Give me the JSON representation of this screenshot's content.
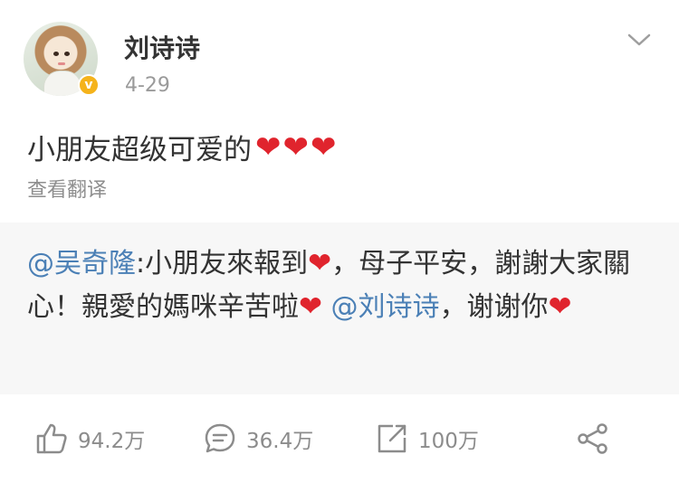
{
  "post": {
    "username": "刘诗诗",
    "date": "4-29",
    "text": "小朋友超级可爱的",
    "hearts": "❤❤❤",
    "translate_label": "查看翻译"
  },
  "repost": {
    "mention1": "@吴奇隆",
    "part1": ":小朋友來報到",
    "part2": "，母子平安，謝謝大家關心！親愛的媽咪辛苦啦",
    "mention2": "@刘诗诗",
    "part3": "，谢谢你",
    "heart": "❤"
  },
  "actions": {
    "like_count": "94.2万",
    "comment_count": "36.4万",
    "share_count": "100万"
  },
  "icons": {
    "menu": "chevron-down-icon",
    "verified": "verified-badge-icon",
    "like": "thumbs-up-icon",
    "comment": "comment-icon",
    "share": "forward-icon",
    "more": "share-network-icon"
  },
  "colors": {
    "heart": "#e0242d",
    "mention": "#4b80b6",
    "verified": "#f5b31b",
    "secondary_text": "#9a9a9a"
  }
}
